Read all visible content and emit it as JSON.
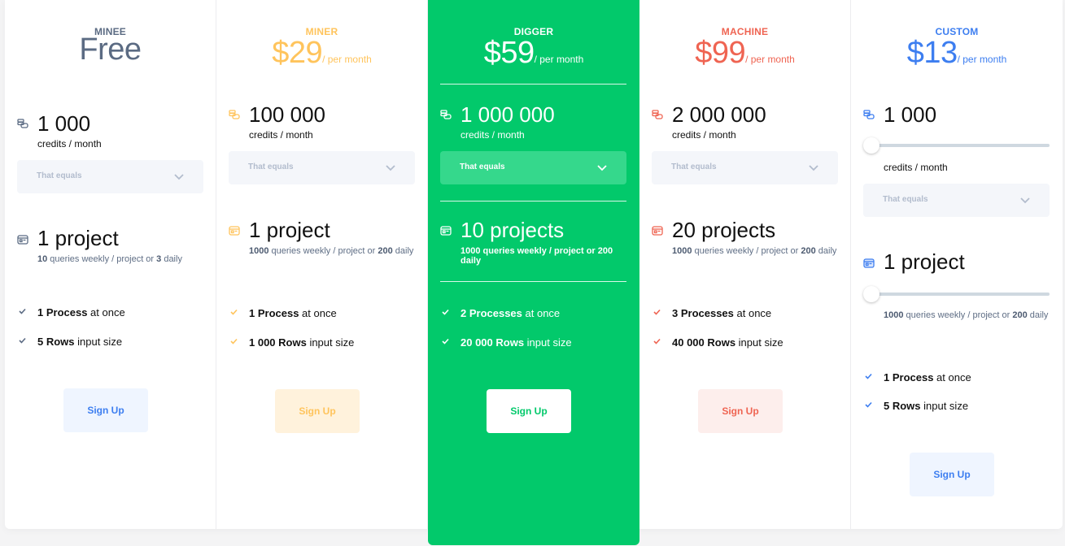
{
  "plans": [
    {
      "name": "MINEE",
      "price": "Free",
      "per": "",
      "color": "#5b6b83",
      "credits": "1 000",
      "credits_unit": "credits / month",
      "dropdown_label": "That equals",
      "projects": "1 project",
      "queries_weekly": "10",
      "queries_mid": " queries weekly / project or ",
      "queries_daily": "3",
      "queries_tail": " daily",
      "features": [
        {
          "bold": "1 Process",
          "rest": " at once"
        },
        {
          "bold": "5 Rows",
          "rest": " input size"
        }
      ],
      "signup": "Sign Up",
      "button_bg": "#eff5ff",
      "button_color": "#3d7ef0"
    },
    {
      "name": "MINER",
      "price": "$29",
      "per": "/ per month",
      "color": "#ffc45c",
      "credits": "100 000",
      "credits_unit": "credits / month",
      "dropdown_label": "That equals",
      "projects": "1 project",
      "queries_weekly": "1000",
      "queries_mid": " queries weekly / project or ",
      "queries_daily": "200",
      "queries_tail": " daily",
      "features": [
        {
          "bold": "1 Process",
          "rest": " at once"
        },
        {
          "bold": "1 000 Rows",
          "rest": " input size"
        }
      ],
      "signup": "Sign Up",
      "button_bg": "#fff2dc",
      "button_color": "#ffc45c"
    },
    {
      "name": "DIGGER",
      "price": "$59",
      "per": "/ per month",
      "color": "#ffffff",
      "credits": "1 000 000",
      "credits_unit": "credits / month",
      "dropdown_label": "That equals",
      "projects": "10 projects",
      "queries_weekly": "1000",
      "queries_mid": " queries weekly / project or ",
      "queries_daily": "200",
      "queries_tail": " daily",
      "features": [
        {
          "bold": "2 Processes",
          "rest": " at once"
        },
        {
          "bold": "20 000 Rows",
          "rest": " input size"
        }
      ],
      "signup": "Sign Up",
      "button_bg": "#ffffff",
      "button_color": "#02c96b",
      "featured": true
    },
    {
      "name": "MACHINE",
      "price": "$99",
      "per": "/ per month",
      "color": "#ef6452",
      "credits": "2 000 000",
      "credits_unit": "credits / month",
      "dropdown_label": "That equals",
      "projects": "20 projects",
      "queries_weekly": "1000",
      "queries_mid": " queries weekly / project or ",
      "queries_daily": "200",
      "queries_tail": " daily",
      "features": [
        {
          "bold": "3 Processes",
          "rest": " at once"
        },
        {
          "bold": "40 000 Rows",
          "rest": " input size"
        }
      ],
      "signup": "Sign Up",
      "button_bg": "#fdeeec",
      "button_color": "#ef6452"
    },
    {
      "name": "CUSTOM",
      "price": "$13",
      "per": "/ per month",
      "color": "#3d7ef0",
      "credits": "1 000",
      "credits_unit": "credits / month",
      "credits_slider_value": 0,
      "dropdown_label": "That equals",
      "projects": "1 project",
      "projects_slider_value": 0,
      "queries_weekly": "1000",
      "queries_mid": " queries weekly / project or ",
      "queries_daily": "200",
      "queries_tail": " daily",
      "features": [
        {
          "bold": "1 Process",
          "rest": " at once"
        },
        {
          "bold": "5 Rows",
          "rest": " input size"
        }
      ],
      "signup": "Sign Up",
      "button_bg": "#eff5ff",
      "button_color": "#3d7ef0"
    }
  ],
  "icons": {
    "credits": "coins-icon",
    "projects": "card-icon",
    "feature": "check-icon",
    "dropdown": "chevron-down-icon"
  }
}
